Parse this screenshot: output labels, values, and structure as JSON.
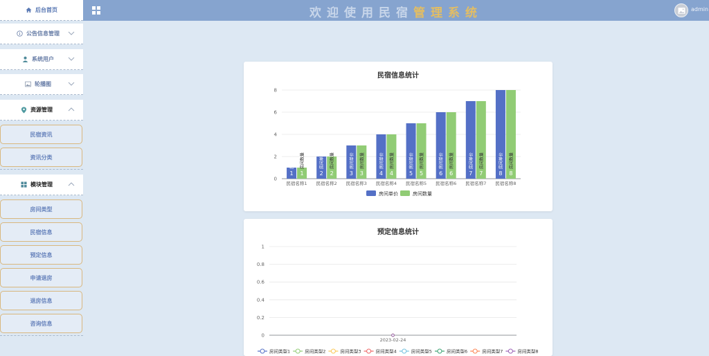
{
  "sidebar": {
    "home": "后台首页",
    "groups": [
      {
        "label": "公告信息管理",
        "icon": "info-icon",
        "open": false
      },
      {
        "label": "系统用户",
        "icon": "user-icon",
        "open": false
      },
      {
        "label": "轮播图",
        "icon": "image-icon",
        "open": false
      },
      {
        "label": "资源管理",
        "icon": "location-pin-icon",
        "open": true,
        "items": [
          "民宿资讯",
          "资讯分类"
        ]
      },
      {
        "label": "模块管理",
        "icon": "grid-icon",
        "open": true,
        "items": [
          "房间类型",
          "民宿信息",
          "预定信息",
          "申请退房",
          "退房信息",
          "咨询信息"
        ]
      }
    ]
  },
  "header": {
    "title_part1": "欢迎使用民宿",
    "title_part2": "管理系统",
    "username": "admin",
    "colors": {
      "bar": "#86a4cf",
      "title_part1": "#c8d6ea",
      "title_part2": "#e3bd63"
    }
  },
  "chart_data": [
    {
      "type": "bar",
      "title": "民宿信息统计",
      "categories": [
        "民宿名称1",
        "民宿名称2",
        "民宿名称3",
        "民宿名称4",
        "民宿名称5",
        "民宿名称6",
        "民宿名称7",
        "民宿名称8"
      ],
      "series": [
        {
          "name": "房间单价",
          "values": [
            1,
            2,
            3,
            4,
            5,
            6,
            7,
            8
          ],
          "color": "#5470c6"
        },
        {
          "name": "房间数量",
          "values": [
            1,
            2,
            3,
            4,
            5,
            6,
            7,
            8
          ],
          "color": "#91cc75"
        }
      ],
      "yticks": [
        0,
        2,
        4,
        6,
        8
      ],
      "ylim": [
        0,
        8
      ],
      "bar_label_series_name": true,
      "legend": "bottom",
      "grid": true
    },
    {
      "type": "line",
      "title": "预定信息统计",
      "x": [
        "2023-02-24"
      ],
      "series": [
        {
          "name": "房间类型1",
          "values": [
            0
          ],
          "color": "#5470c6"
        },
        {
          "name": "房间类型2",
          "values": [
            0
          ],
          "color": "#91cc75"
        },
        {
          "name": "房间类型3",
          "values": [
            0
          ],
          "color": "#fac858"
        },
        {
          "name": "房间类型4",
          "values": [
            0
          ],
          "color": "#ee6666"
        },
        {
          "name": "房间类型5",
          "values": [
            0
          ],
          "color": "#73c0de"
        },
        {
          "name": "房间类型6",
          "values": [
            0
          ],
          "color": "#3ba272"
        },
        {
          "name": "房间类型7",
          "values": [
            0
          ],
          "color": "#fc8452"
        },
        {
          "name": "房间类型8",
          "values": [
            0
          ],
          "color": "#9a60b4"
        }
      ],
      "yticks": [
        "0",
        "0.2",
        "0.4",
        "0.6",
        "0.8",
        "1"
      ],
      "ylim": [
        0,
        1
      ],
      "legend": "bottom",
      "grid": true
    }
  ]
}
